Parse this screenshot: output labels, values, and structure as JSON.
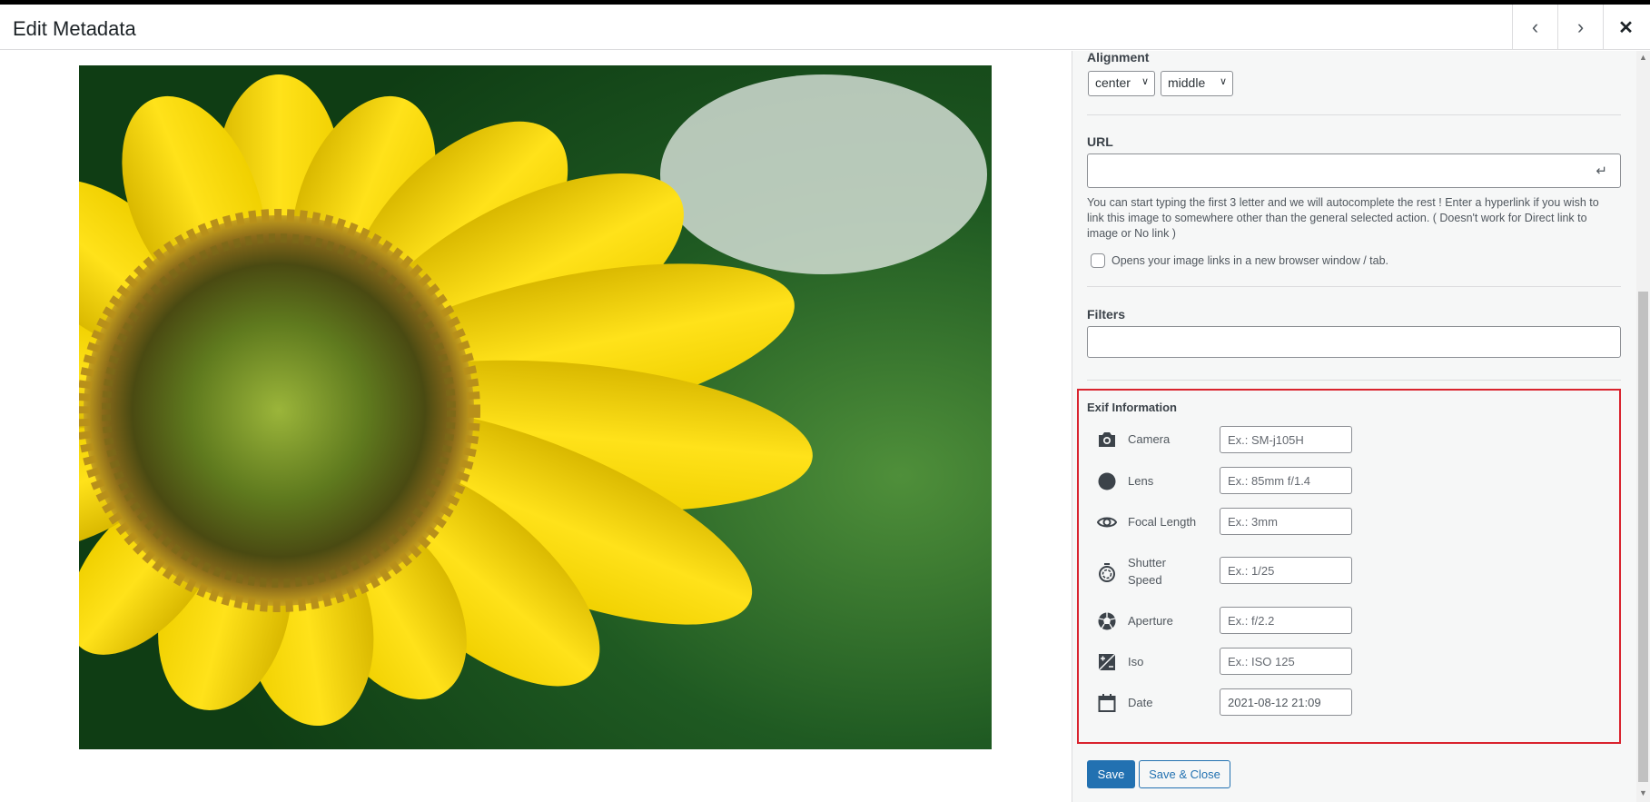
{
  "header": {
    "title": "Edit Metadata",
    "prev_icon": "chevron-left",
    "next_icon": "chevron-right",
    "close_icon": "close"
  },
  "alignment": {
    "label": "Alignment",
    "horizontal": "center",
    "vertical": "middle"
  },
  "url": {
    "label": "URL",
    "value": "",
    "help": "You can start typing the first 3 letter and we will autocomplete the rest ! Enter a hyperlink if you wish to link this image to somewhere other than the general selected action. ( Doesn't work for Direct link to image or No link )",
    "new_window_label": "Opens your image links in a new browser window / tab.",
    "new_window_checked": false
  },
  "filters": {
    "label": "Filters",
    "value": ""
  },
  "exif": {
    "title": "Exif Information",
    "rows": [
      {
        "icon": "camera",
        "label": "Camera",
        "placeholder": "Ex.: SM-j105H",
        "value": ""
      },
      {
        "icon": "lens",
        "label": "Lens",
        "placeholder": "Ex.: 85mm f/1.4",
        "value": ""
      },
      {
        "icon": "eye",
        "label": "Focal Length",
        "placeholder": "Ex.: 3mm",
        "value": ""
      },
      {
        "icon": "stopwatch",
        "label": "Shutter Speed",
        "placeholder": "Ex.: 1/25",
        "value": ""
      },
      {
        "icon": "aperture",
        "label": "Aperture",
        "placeholder": "Ex.: f/2.2",
        "value": ""
      },
      {
        "icon": "exposure",
        "label": "Iso",
        "placeholder": "Ex.: ISO 125",
        "value": ""
      },
      {
        "icon": "calendar",
        "label": "Date",
        "placeholder": "",
        "value": "2021-08-12 21:09"
      }
    ]
  },
  "actions": {
    "save": "Save",
    "save_close": "Save & Close"
  },
  "colors": {
    "accent": "#2271b1",
    "highlight": "#d9232e"
  }
}
